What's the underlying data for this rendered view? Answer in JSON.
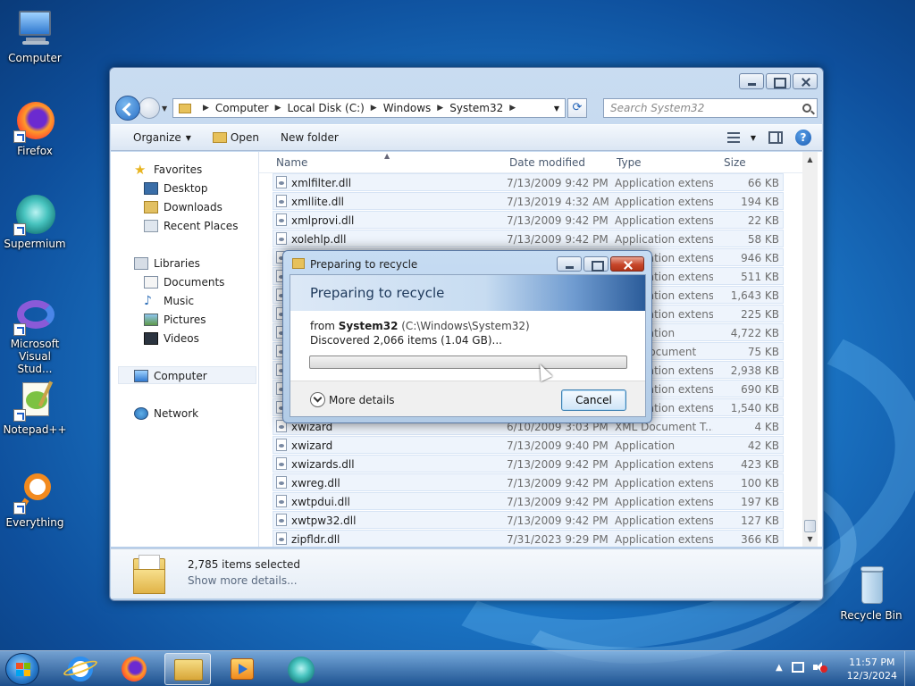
{
  "desktop": {
    "icons": [
      {
        "label": "Computer"
      },
      {
        "label": "Firefox"
      },
      {
        "label": "Supermium"
      },
      {
        "label": "Microsoft Visual Stud..."
      },
      {
        "label": "Notepad++"
      },
      {
        "label": "Everything"
      },
      {
        "label": "Recycle Bin"
      }
    ]
  },
  "explorer": {
    "breadcrumb": [
      "Computer",
      "Local Disk (C:)",
      "Windows",
      "System32"
    ],
    "search_placeholder": "Search System32",
    "toolbar": {
      "organize": "Organize",
      "open": "Open",
      "new_folder": "New folder"
    },
    "nav": {
      "favorites": "Favorites",
      "desktop": "Desktop",
      "downloads": "Downloads",
      "recent": "Recent Places",
      "libraries": "Libraries",
      "documents": "Documents",
      "music": "Music",
      "pictures": "Pictures",
      "videos": "Videos",
      "computer": "Computer",
      "network": "Network"
    },
    "columns": {
      "name": "Name",
      "date": "Date modified",
      "type": "Type",
      "size": "Size"
    },
    "rows": [
      {
        "name": "xmlfilter.dll",
        "date": "7/13/2009 9:42 PM",
        "type": "Application extens...",
        "size": "66 KB"
      },
      {
        "name": "xmllite.dll",
        "date": "7/13/2019 4:32 AM",
        "type": "Application extens...",
        "size": "194 KB"
      },
      {
        "name": "xmlprovi.dll",
        "date": "7/13/2009 9:42 PM",
        "type": "Application extens...",
        "size": "22 KB"
      },
      {
        "name": "xolehlp.dll",
        "date": "7/13/2009 9:42 PM",
        "type": "Application extens...",
        "size": "58 KB"
      },
      {
        "name": "",
        "date": "",
        "type": "Application extens...",
        "size": "946 KB"
      },
      {
        "name": "",
        "date": "",
        "type": "Application extens...",
        "size": "511 KB"
      },
      {
        "name": "",
        "date": "",
        "type": "Application extens...",
        "size": "1,643 KB"
      },
      {
        "name": "",
        "date": "",
        "type": "Application extens...",
        "size": "225 KB"
      },
      {
        "name": "",
        "date": "",
        "type": "Application",
        "size": "4,722 KB"
      },
      {
        "name": "",
        "date": "",
        "type": "XML Document",
        "size": "75 KB"
      },
      {
        "name": "",
        "date": "",
        "type": "Application extens...",
        "size": "2,938 KB"
      },
      {
        "name": "",
        "date": "",
        "type": "Application extens...",
        "size": "690 KB"
      },
      {
        "name": "",
        "date": "",
        "type": "Application extens...",
        "size": "1,540 KB"
      },
      {
        "name": "xwizard",
        "date": "6/10/2009 3:03 PM",
        "type": "XML Document T...",
        "size": "4 KB"
      },
      {
        "name": "xwizard",
        "date": "7/13/2009 9:40 PM",
        "type": "Application",
        "size": "42 KB"
      },
      {
        "name": "xwizards.dll",
        "date": "7/13/2009 9:42 PM",
        "type": "Application extens...",
        "size": "423 KB"
      },
      {
        "name": "xwreg.dll",
        "date": "7/13/2009 9:42 PM",
        "type": "Application extens...",
        "size": "100 KB"
      },
      {
        "name": "xwtpdui.dll",
        "date": "7/13/2009 9:42 PM",
        "type": "Application extens...",
        "size": "197 KB"
      },
      {
        "name": "xwtpw32.dll",
        "date": "7/13/2009 9:42 PM",
        "type": "Application extens...",
        "size": "127 KB"
      },
      {
        "name": "zipfldr.dll",
        "date": "7/31/2023 9:29 PM",
        "type": "Application extens...",
        "size": "366 KB"
      }
    ],
    "details": {
      "count": "2,785 items selected",
      "more": "Show more details..."
    }
  },
  "dialog": {
    "title": "Preparing to recycle",
    "header": "Preparing to recycle",
    "from_prefix": "from ",
    "from_name": "System32",
    "from_path": " (C:\\Windows\\System32)",
    "discovered": "Discovered 2,066 items (1.04 GB)...",
    "progress": 0,
    "more_details": "More details",
    "cancel": "Cancel"
  },
  "taskbar": {
    "time": "11:57 PM",
    "date": "12/3/2024"
  }
}
